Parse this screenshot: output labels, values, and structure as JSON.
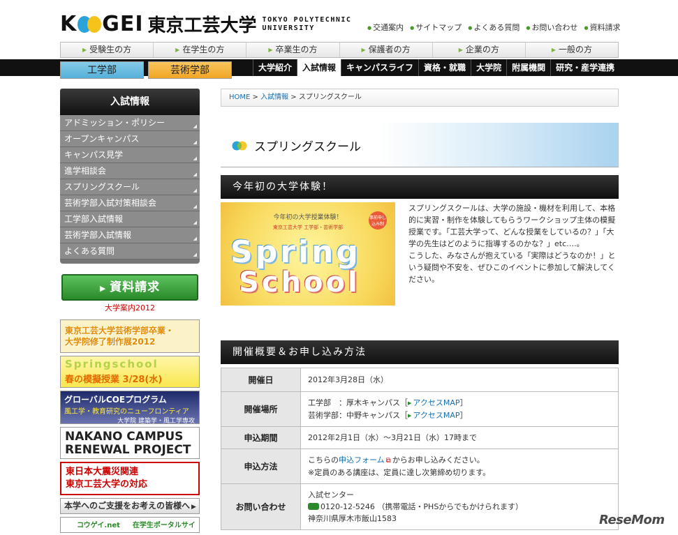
{
  "header": {
    "logo_koogei_k": "K",
    "logo_koogei_rest": "GEI",
    "logo_jp": "東京工芸大学",
    "logo_en_line1": "TOKYO POLYTECHNIC",
    "logo_en_line2": "UNIVERSITY",
    "util_links": [
      "交通案内",
      "サイトマップ",
      "よくある質問",
      "お問い合わせ",
      "資料請求"
    ]
  },
  "visitor_nav": [
    "受験生の方",
    "在学生の方",
    "卒業生の方",
    "保護者の方",
    "企業の方",
    "一般の方"
  ],
  "dept_tabs": {
    "engineering": "工学部",
    "arts": "芸術学部"
  },
  "main_nav": [
    "大学紹介",
    "入試情報",
    "キャンパスライフ",
    "資格・就職",
    "大学院",
    "附属機関",
    "研究・産学連携"
  ],
  "sidebar": {
    "title": "入試情報",
    "items": [
      "アドミッション・ポリシー",
      "オープンキャンパス",
      "キャンパス見学",
      "進学相談会",
      "スプリングスクール",
      "芸術学部入試対策相談会",
      "工学部入試情報",
      "芸術学部入試情報",
      "よくある質問"
    ],
    "request_button": "資料請求",
    "request_sub": "大学案内2012",
    "banners": {
      "b1_line1": "東京工芸大学芸術学部卒業・",
      "b1_line2": "大学院修了制作展2012",
      "b2_line1": "Springschool",
      "b2_line2": "春の模擬授業 3/28(水)",
      "b3_line1": "グローバルCOEプログラム",
      "b3_line2": "風工学・教育研究のニューフロンティア",
      "b3_line3": "大学院 建築学・風工学専攻",
      "b4_line1": "NAKANO CAMPUS",
      "b4_line2": "RENEWAL PROJECT",
      "b5_line1": "東日本大震災関連",
      "b5_line2": "東京工芸大学の対応",
      "b6": "本学へのご支援をお考えの皆様へ",
      "b7": "コウゲイ.net",
      "b7_sub": "在学生ポータルサイト"
    }
  },
  "breadcrumb": {
    "home": "HOME",
    "sep": ">",
    "parent": "入試情報",
    "current": "スプリングスクール"
  },
  "page_title": "スプリングスクール",
  "section1": {
    "heading": "今年初の大学体験！",
    "promo_top": "今年初の大学授業体験！",
    "promo_sub": "東京工芸大学 工学部・芸術学部",
    "promo_badge": "事前申し込み制",
    "promo_spring": "Spring",
    "promo_school": "School",
    "intro_p1": "スプリングスクールは、大学の施設・機材を利用して、本格的に実習・制作を体験してもらうワークショップ主体の模擬授業です。「工芸大学って、どんな授業をしているの？」「大学の先生はどのように指導するのかな？」etc….。",
    "intro_p2": "こうした、みなさんが抱えている「実際はどうなのか！」という疑問や不安を、ぜひこのイベントに参加して解決してください。"
  },
  "section2": {
    "heading": "開催概要＆お申し込み方法",
    "rows": [
      {
        "label": "開催日",
        "line1": "2012年3月28日（水）"
      },
      {
        "label": "開催場所",
        "line1_pre": "工学部　：厚木キャンパス［",
        "line1_link": "アクセスMAP",
        "line1_post": "］",
        "line2_pre": "芸術学部：中野キャンパス［",
        "line2_link": "アクセスMAP",
        "line2_post": "］"
      },
      {
        "label": "申込期間",
        "line1": "2012年2月1日（水）～3月21日（水）17時まで"
      },
      {
        "label": "申込方法",
        "line1_pre": "こちらの",
        "line1_link": "申込フォーム",
        "line1_post": "からお申し込みください。",
        "line2": "※定員のある講座は、定員に達し次第締め切ります。"
      },
      {
        "label": "お問い合わせ",
        "line1": "入試センター",
        "line2": "0120-12-5246 （携帯電話・PHSからでもかけられます）",
        "line3": "神奈川県厚木市飯山1583"
      }
    ]
  },
  "watermark": "ReseMom",
  "colors": {
    "logo_blue": "#2aa3d8",
    "logo_yellow": "#f6c21c",
    "logo_green": "#7cc042",
    "accent_green": "#2a8a2a",
    "link_blue": "#1a6fb0"
  }
}
